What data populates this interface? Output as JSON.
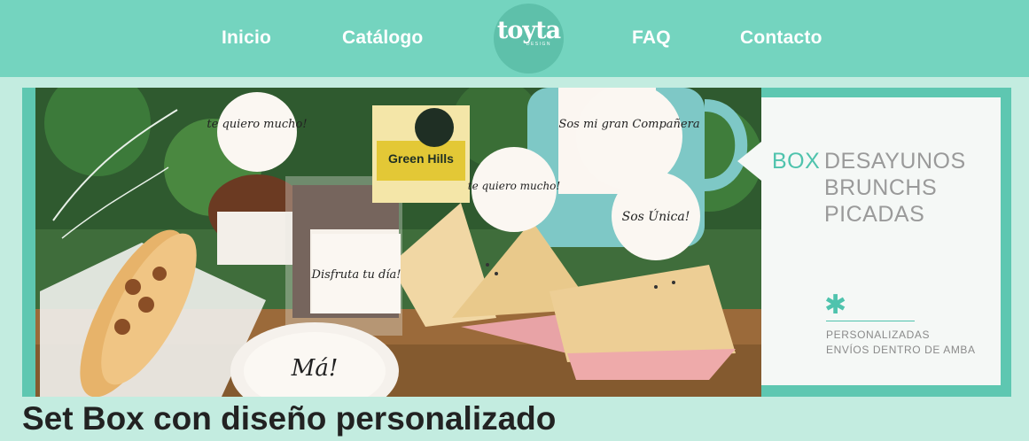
{
  "nav": {
    "items": [
      {
        "label": "Inicio"
      },
      {
        "label": "Catálogo"
      },
      {
        "label": "FAQ"
      },
      {
        "label": "Contacto"
      }
    ],
    "logo": {
      "name": "toyta",
      "sub": "DESIGN"
    }
  },
  "banner": {
    "photo_tags": [
      "te quiero mucho!",
      "Sos mi gran Compañera",
      "Green Hills",
      "te quiero mucho!",
      "Sos Única!",
      "Disfruta tu día!",
      "Má!"
    ],
    "box_word": "BOX",
    "lines": [
      "DESAYUNOS",
      "BRUNCHS",
      "PICADAS"
    ],
    "small_lines": [
      "PERSONALIZADAS",
      "ENVÍOS DENTRO DE AMBA"
    ],
    "icon": "asterisk-icon"
  },
  "page": {
    "title": "Set Box con diseño personalizado"
  },
  "colors": {
    "nav_bg": "#74d4bf",
    "page_bg": "#c3ece0",
    "accent": "#4fc3ad",
    "frame": "#5ec7b1"
  }
}
